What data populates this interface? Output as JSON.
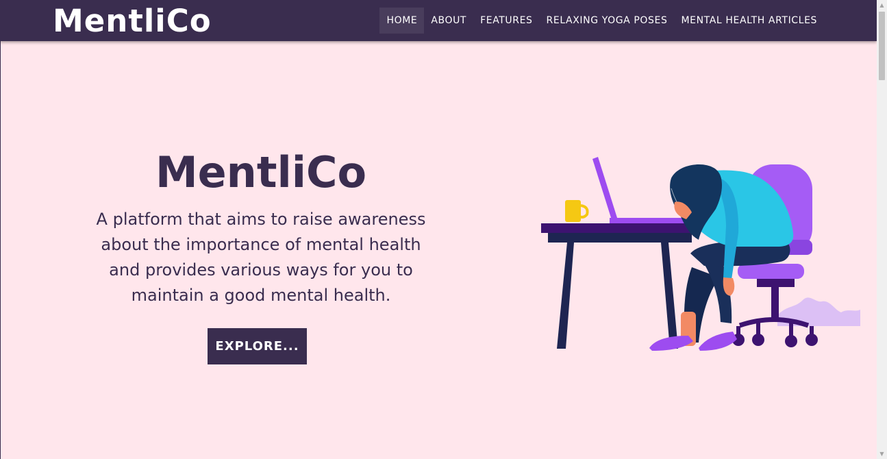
{
  "navbar": {
    "brand": "MentliCo",
    "items": [
      {
        "label": "HOME",
        "active": true
      },
      {
        "label": "ABOUT"
      },
      {
        "label": "FEATURES"
      },
      {
        "label": "RELAXING YOGA POSES"
      },
      {
        "label": "MENTAL HEALTH ARTICLES"
      }
    ]
  },
  "hero": {
    "title": "MentliCo",
    "description": "A platform that aims to raise awareness about the importance of mental health and provides various ways for you to maintain a good mental health.",
    "button_label": "EXPLORE..."
  },
  "illustration": {
    "icon": "tired-woman-at-desk-illustration"
  },
  "colors": {
    "nav_bg": "#3a2d4f",
    "page_bg": "#ffe6ec",
    "accent_purple": "#9d4cf0",
    "accent_cyan": "#2ac6e6"
  }
}
